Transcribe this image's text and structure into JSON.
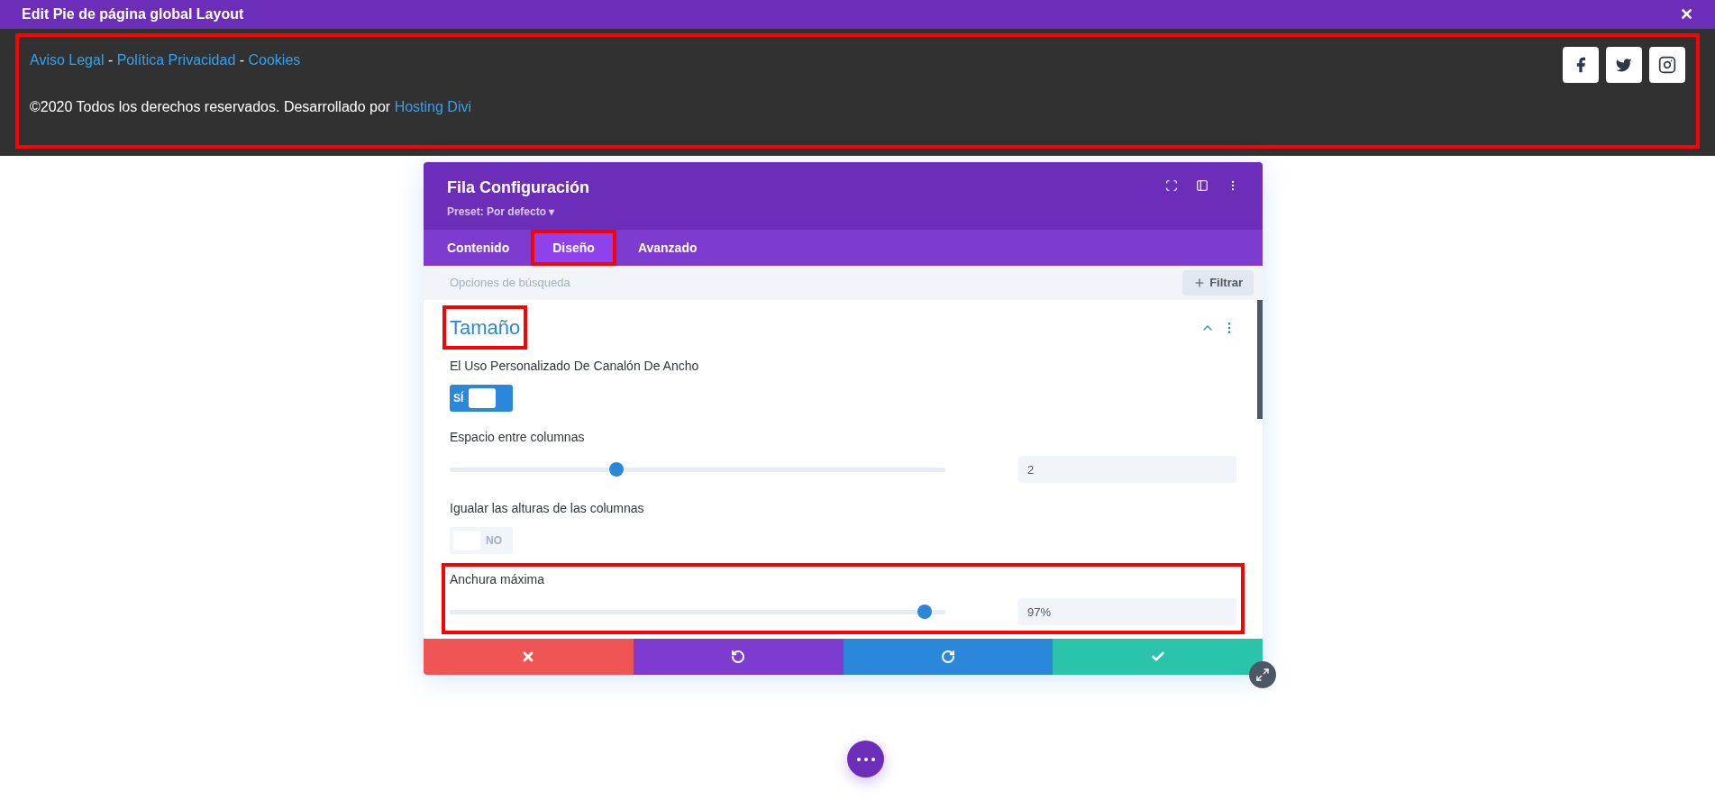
{
  "top_bar": {
    "title": "Edit Pie de página global Layout",
    "close": "✕"
  },
  "footer": {
    "highlighted": true,
    "links": [
      {
        "text": "Aviso Legal",
        "kind": "link"
      },
      {
        "text": " - ",
        "kind": "text"
      },
      {
        "text": "Política Privacidad",
        "kind": "link"
      },
      {
        "text": " - ",
        "kind": "text"
      },
      {
        "text": "Cookies",
        "kind": "link"
      }
    ],
    "copyright": "©2020 Todos los derechos reservados. Desarrollado por",
    "copyright_link": "Hosting Divi",
    "social": [
      {
        "kind": "facebook"
      },
      {
        "kind": "twitter"
      },
      {
        "kind": "instagram"
      }
    ]
  },
  "modal": {
    "title": "Fila Configuración",
    "preset": "Preset: Por defecto",
    "preset_caret": "▾",
    "tabs": [
      {
        "label": "Contenido",
        "selected": false,
        "highlighted": false
      },
      {
        "label": "Diseño",
        "selected": true,
        "highlighted": true
      },
      {
        "label": "Avanzado",
        "selected": false,
        "highlighted": false
      }
    ],
    "search": {
      "placeholder": "Opciones de búsqueda"
    },
    "filter": "Filtrar",
    "section": {
      "title": "Tamaño",
      "expanded": true,
      "highlighted": true
    },
    "settings": [
      {
        "kind": "toggle",
        "label": "El Uso Personalizado De Canalón De Ancho",
        "on": true,
        "text": "SÍ",
        "highlighted": false
      },
      {
        "kind": "slider",
        "label": "Espacio entre columnas",
        "level": 0.336,
        "value": "2",
        "highlighted": false
      },
      {
        "kind": "toggle",
        "label": "Igualar las alturas de las columnas",
        "on": false,
        "text": "NO",
        "highlighted": false
      },
      {
        "kind": "slider",
        "label": "Anchura máxima",
        "level": 0.958,
        "value": "97%",
        "highlighted": true
      }
    ]
  }
}
